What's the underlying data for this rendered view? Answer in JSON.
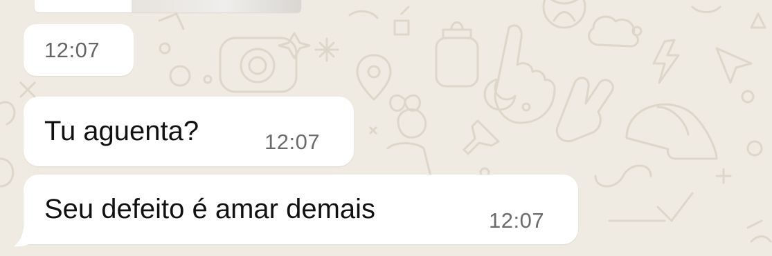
{
  "chat": {
    "previous_media": {
      "icon": "image-thumbnail"
    },
    "standalone_time": "12:07",
    "messages": [
      {
        "text": "Tu aguenta?",
        "time": "12:07"
      },
      {
        "text": "Seu defeito é amar demais",
        "time": "12:07"
      }
    ]
  },
  "colors": {
    "background": "#efeae2",
    "doodle": "#ded7ca",
    "bubble": "#ffffff",
    "text": "#111111",
    "timestamp": "#6b6b6b"
  }
}
